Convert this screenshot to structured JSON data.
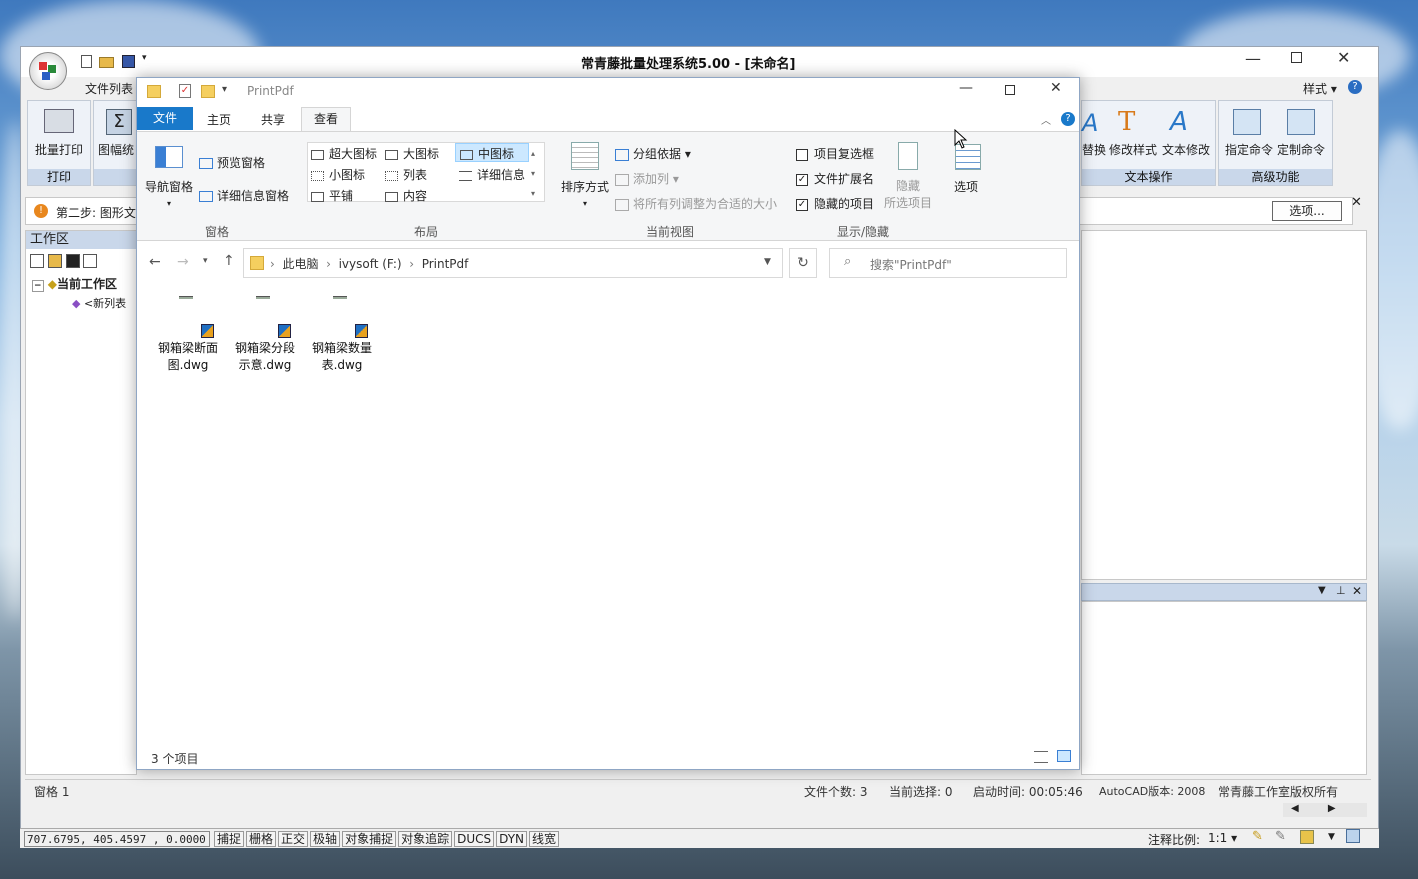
{
  "app": {
    "title": "常青藤批量处理系统5.00 - [未命名]",
    "menu_file_list": "文件列表",
    "style_menu": "样式",
    "ribbon_left": [
      {
        "label": "批量打印",
        "group": "打印"
      },
      {
        "label": "图幅统"
      }
    ],
    "ribbon_right_groups": [
      {
        "name": "文本操作",
        "items": [
          "替换",
          "修改样式",
          "文本修改"
        ]
      },
      {
        "name": "高级功能",
        "items": [
          "指定命令",
          "定制命令"
        ]
      }
    ],
    "step_text": "第二步: 图形文",
    "options_button": "选项...",
    "workspace_title": "工作区",
    "tree_root": "当前工作区",
    "tree_child": "<新列表",
    "status": {
      "pane": "窗格 1",
      "file_count": "文件个数: 3",
      "current_sel": "当前选择: 0",
      "start_time": "启动时间: 00:05:46",
      "autocad": "AutoCAD版本: 2008",
      "copyright": "常青藤工作室版权所有"
    }
  },
  "autocad_bar": {
    "coords": "707.6795,  405.4597 , 0.0000",
    "toggles": [
      "捕捉",
      "栅格",
      "正交",
      "极轴",
      "对象捕捉",
      "对象追踪",
      "DUCS",
      "DYN",
      "线宽"
    ],
    "scale_label": "注释比例:",
    "scale_value": "1:1"
  },
  "explorer": {
    "title": "PrintPdf",
    "tabs": [
      "文件",
      "主页",
      "共享",
      "查看"
    ],
    "active_tab": "查看",
    "panes_group": {
      "label": "窗格",
      "nav_pane": "导航窗格",
      "preview_pane": "预览窗格",
      "details_pane": "详细信息窗格"
    },
    "layout_group": {
      "label": "布局",
      "items": [
        "超大图标",
        "大图标",
        "中图标",
        "小图标",
        "列表",
        "详细信息",
        "平铺",
        "内容"
      ],
      "selected": "中图标"
    },
    "current_view_group": {
      "label": "当前视图",
      "sort": "排序方式",
      "group_by": "分组依据",
      "add_column": "添加列",
      "fit_columns": "将所有列调整为合适的大小"
    },
    "show_hide_group": {
      "label": "显示/隐藏",
      "item_checkboxes": {
        "label": "项目复选框",
        "checked": false
      },
      "file_extensions": {
        "label": "文件扩展名",
        "checked": true
      },
      "hidden_items": {
        "label": "隐藏的项目",
        "checked": true
      },
      "hide_selected": "隐藏",
      "hide_selected_2": "所选项目",
      "options": "选项"
    },
    "breadcrumb": [
      "此电脑",
      "ivysoft (F:)",
      "PrintPdf"
    ],
    "search_placeholder": "搜索\"PrintPdf\"",
    "files": [
      {
        "line1": "钢箱梁断面",
        "line2": "图.dwg"
      },
      {
        "line1": "钢箱梁分段",
        "line2": "示意.dwg"
      },
      {
        "line1": "钢箱梁数量",
        "line2": "表.dwg"
      }
    ],
    "item_count": "3 个项目",
    "colors": {
      "accent": "#1979ca",
      "selected": "#cce8ff"
    }
  }
}
